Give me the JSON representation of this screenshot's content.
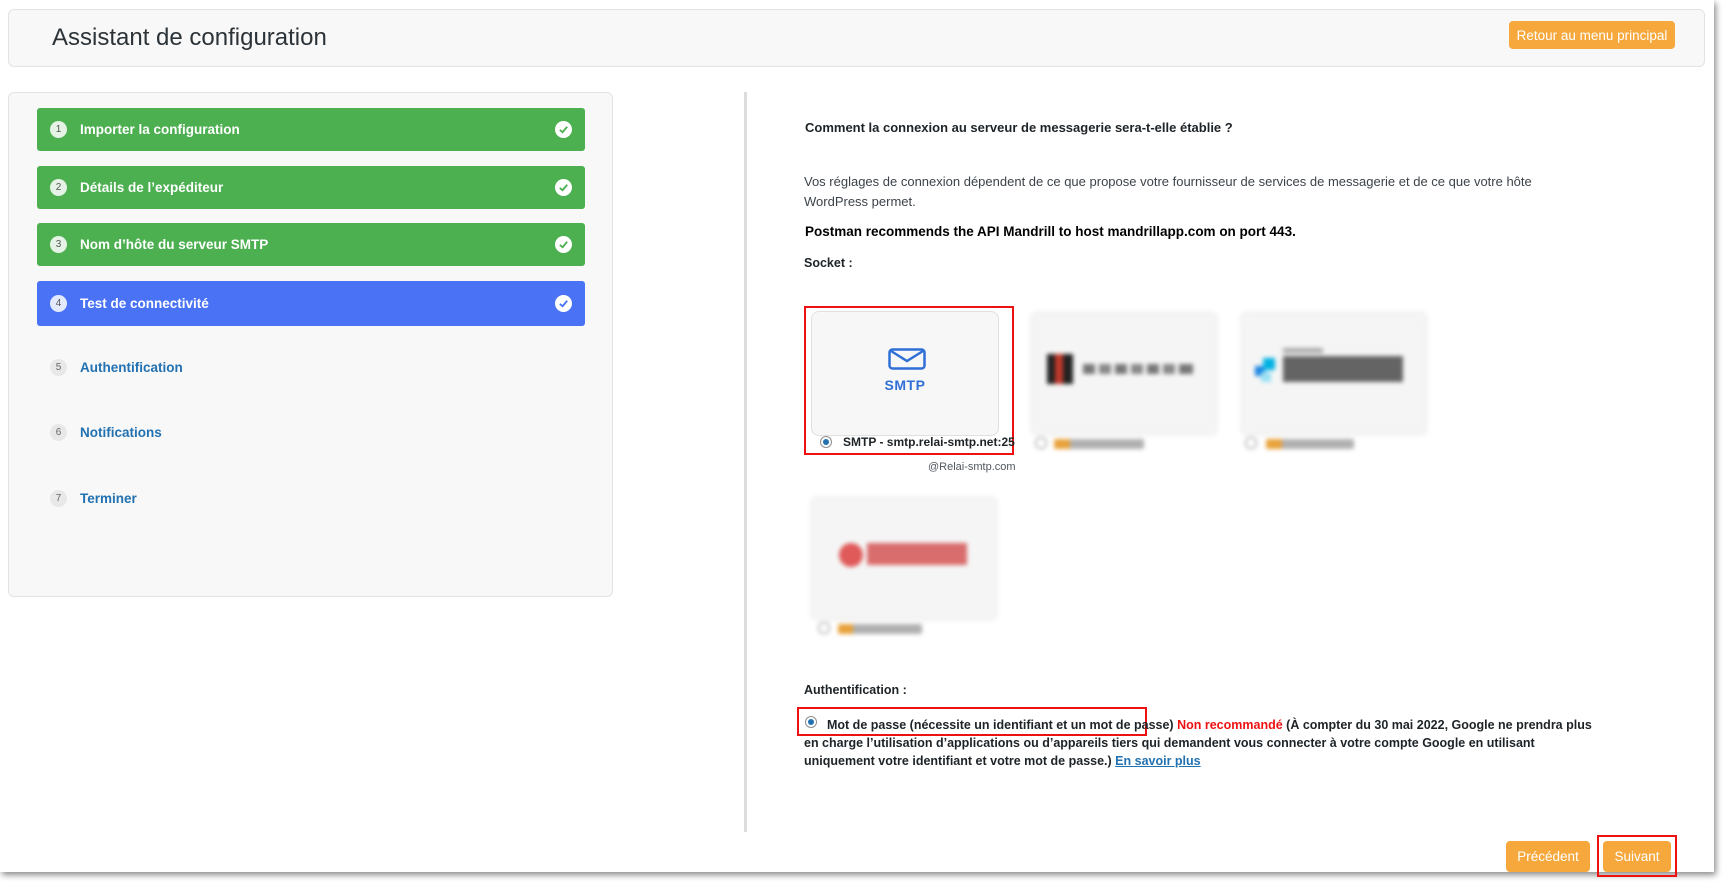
{
  "header": {
    "title": "Assistant de configuration",
    "back_button": "Retour au menu principal"
  },
  "steps": [
    {
      "num": "1",
      "label": "Importer la configuration",
      "state": "done"
    },
    {
      "num": "2",
      "label": "Détails de l’expéditeur",
      "state": "done"
    },
    {
      "num": "3",
      "label": "Nom d’hôte du serveur SMTP",
      "state": "done"
    },
    {
      "num": "4",
      "label": "Test de connectivité",
      "state": "active"
    },
    {
      "num": "5",
      "label": "Authentification",
      "state": "pending"
    },
    {
      "num": "6",
      "label": "Notifications",
      "state": "pending"
    },
    {
      "num": "7",
      "label": "Terminer",
      "state": "pending"
    }
  ],
  "content": {
    "question": "Comment la connexion au serveur de messagerie sera-t-elle établie ?",
    "description": "Vos réglages de connexion dépendent de ce que propose votre fournisseur de services de messagerie et de ce que votre hôte WordPress permet.",
    "recommendation": "Postman recommends the API Mandrill to host mandrillapp.com on port 443.",
    "socket_label": "Socket :",
    "smtp_card_text": "SMTP",
    "smtp_option": "SMTP - smtp.relai-smtp.net:25",
    "smtp_sub": "@Relai-smtp.com",
    "auth_label": "Authentification :",
    "auth_option": "Mot de passe (nécessite un identifiant et un mot de passe)",
    "auth_warning": "Non recommandé",
    "auth_note": "(À compter du 30 mai 2022, Google ne prendra plus en charge l’utilisation d’applications ou d’appareils tiers qui demandent vous connecter à votre compte Google en utilisant uniquement votre identifiant et votre mot de passe.)",
    "auth_link": "En savoir plus"
  },
  "footer": {
    "prev": "Précédent",
    "next": "Suivant"
  },
  "colors": {
    "step_done": "#4caf50",
    "step_active": "#4a72f5",
    "accent_orange": "#f7a83c",
    "highlight_red": "#e11111",
    "link_blue": "#2271b1"
  }
}
